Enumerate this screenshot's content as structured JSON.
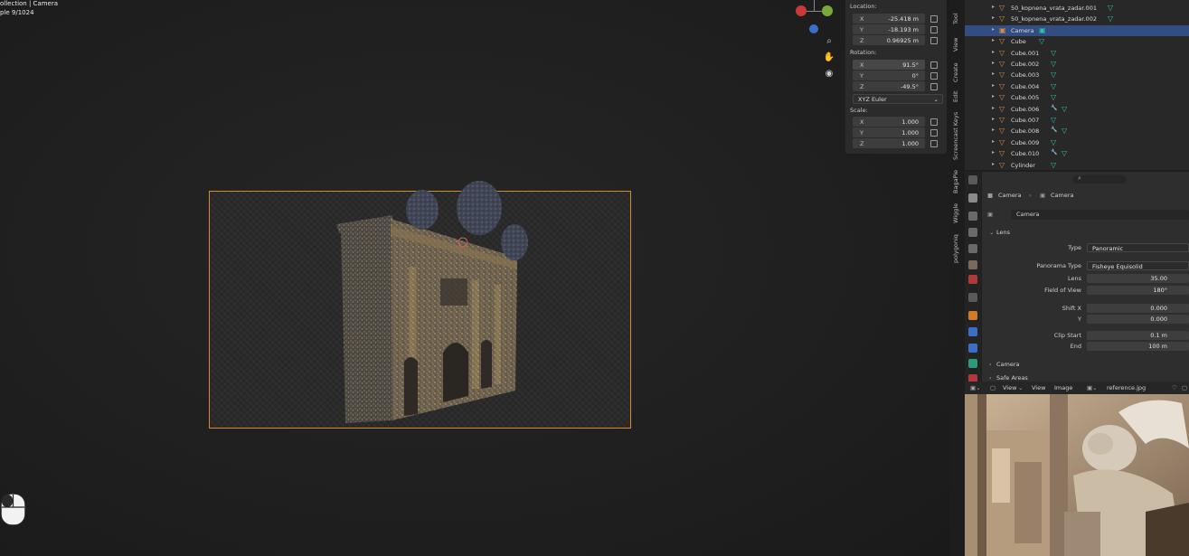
{
  "viewport": {
    "collection_text": "ollection | Camera",
    "sample_text": "ple 9/1024",
    "gizmo_colors": {
      "x": "#c83a3a",
      "y": "#7aa83a",
      "z": "#3a6ec8"
    },
    "frame_color": "#d58a2e"
  },
  "npanel": {
    "location_label": "Location:",
    "location": [
      {
        "axis": "X",
        "value": "-25.418 m"
      },
      {
        "axis": "Y",
        "value": "-18.193 m"
      },
      {
        "axis": "Z",
        "value": "0.96925 m"
      }
    ],
    "rotation_label": "Rotation:",
    "rotation": [
      {
        "axis": "X",
        "value": "91.5°"
      },
      {
        "axis": "Y",
        "value": "0°"
      },
      {
        "axis": "Z",
        "value": "-49.5°"
      }
    ],
    "rotation_mode": "XYZ Euler",
    "scale_label": "Scale:",
    "scale": [
      {
        "axis": "X",
        "value": "1.000"
      },
      {
        "axis": "Y",
        "value": "1.000"
      },
      {
        "axis": "Z",
        "value": "1.000"
      }
    ]
  },
  "vtabs": [
    "Tool",
    "View",
    "Create",
    "Edit",
    "Screencast Keys",
    "BagaPie",
    "Wiggle",
    "polygoniq"
  ],
  "outliner": {
    "items": [
      {
        "name": "50_kopnena_vrata_zadar.001",
        "icon": "mesh-icon",
        "mods": [
          "mesh-data"
        ],
        "selected": false
      },
      {
        "name": "50_kopnena_vrata_zadar.002",
        "icon": "mesh-icon",
        "mods": [
          "mesh-data"
        ],
        "selected": false
      },
      {
        "name": "Camera",
        "icon": "camera-icon",
        "mods": [
          "camera-data"
        ],
        "selected": true
      },
      {
        "name": "Cube",
        "icon": "mesh-icon",
        "mods": [
          "mesh-data"
        ],
        "selected": false
      },
      {
        "name": "Cube.001",
        "icon": "mesh-icon",
        "mods": [
          "mesh-data"
        ],
        "selected": false
      },
      {
        "name": "Cube.002",
        "icon": "mesh-icon",
        "mods": [
          "mesh-data"
        ],
        "selected": false
      },
      {
        "name": "Cube.003",
        "icon": "mesh-icon",
        "mods": [
          "mesh-data"
        ],
        "selected": false
      },
      {
        "name": "Cube.004",
        "icon": "mesh-icon",
        "mods": [
          "mesh-data"
        ],
        "selected": false
      },
      {
        "name": "Cube.005",
        "icon": "mesh-icon",
        "mods": [
          "mesh-data"
        ],
        "selected": false
      },
      {
        "name": "Cube.006",
        "icon": "mesh-icon",
        "mods": [
          "modifier",
          "mesh-data"
        ],
        "selected": false
      },
      {
        "name": "Cube.007",
        "icon": "mesh-icon",
        "mods": [
          "mesh-data"
        ],
        "selected": false
      },
      {
        "name": "Cube.008",
        "icon": "mesh-icon",
        "mods": [
          "modifier",
          "mesh-data"
        ],
        "selected": false
      },
      {
        "name": "Cube.009",
        "icon": "mesh-icon",
        "mods": [
          "mesh-data"
        ],
        "selected": false
      },
      {
        "name": "Cube.010",
        "icon": "mesh-icon",
        "mods": [
          "modifier",
          "mesh-data"
        ],
        "selected": false
      },
      {
        "name": "Cylinder",
        "icon": "mesh-icon",
        "mods": [
          "mesh-data"
        ],
        "selected": false
      }
    ]
  },
  "properties": {
    "breadcrumb": [
      "Camera",
      "Camera"
    ],
    "data_name": "Camera",
    "lens_section": "Lens",
    "fields": [
      {
        "label": "Type",
        "value": "Panoramic",
        "kind": "select"
      },
      {
        "label": "Panorama Type",
        "value": "Fisheye Equisolid",
        "kind": "select"
      },
      {
        "label": "Lens",
        "value": "35.00",
        "kind": "number"
      },
      {
        "label": "Field of View",
        "value": "180°",
        "kind": "number"
      },
      {
        "label": "Shift X",
        "value": "0.000",
        "kind": "number"
      },
      {
        "label": "Y",
        "value": "0.000",
        "kind": "number"
      },
      {
        "label": "Clip Start",
        "value": "0.1 m",
        "kind": "number"
      },
      {
        "label": "End",
        "value": "100 m",
        "kind": "number"
      }
    ],
    "camera_section": "Camera",
    "safe_areas_section": "Safe Areas"
  },
  "image_editor": {
    "menu": [
      "View",
      "View",
      "Image"
    ],
    "image_name": "reference.jpg"
  }
}
